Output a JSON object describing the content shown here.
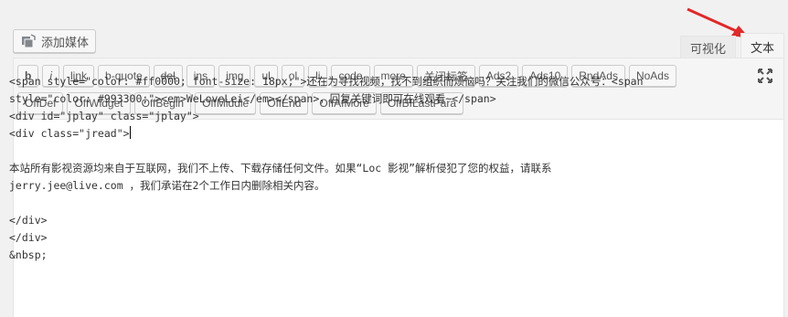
{
  "media_button": {
    "label": "添加媒体",
    "icon": "media-icon"
  },
  "tabs": {
    "visual": "可视化",
    "text": "文本",
    "active": "text"
  },
  "accent_color": "#e22828",
  "toolbar": {
    "row1": [
      "b",
      "i",
      "link",
      "b-quote",
      "del",
      "ins",
      "img",
      "ul",
      "ol",
      "li",
      "code",
      "more",
      "关闭标签",
      "Ads2",
      "Ads10",
      "RndAds",
      "NoAds"
    ],
    "row2": [
      "OffDef",
      "OffWidget",
      "OffBegin",
      "OffMiddle",
      "OffEnd",
      "OffAfMore",
      "OffBfLastPara"
    ],
    "fullscreen_icon": "fullscreen-icon"
  },
  "content": {
    "lines": [
      "<span style=\"color: #ff0000; font-size: 18px;\">还在为寻找视频，找不到组织而烦恼吗？关注我们的微信公众号：<span",
      "style=\"color: #993300;\"><em>WeLoveLei</em></span>，回复关键词即可在线观看~</span>",
      "<div id=\"jplay\" class=\"jplay\">",
      "<div class=\"jread\">",
      "",
      "本站所有影视资源均来自于互联网，我们不上传、下载存储任何文件。如果“Loc 影视”解析侵犯了您的权益，请联系",
      "jerry.jee@live.com ，我们承诺在2个工作日内删除相关内容。",
      "",
      "</div>",
      "</div>",
      "&nbsp;"
    ]
  }
}
